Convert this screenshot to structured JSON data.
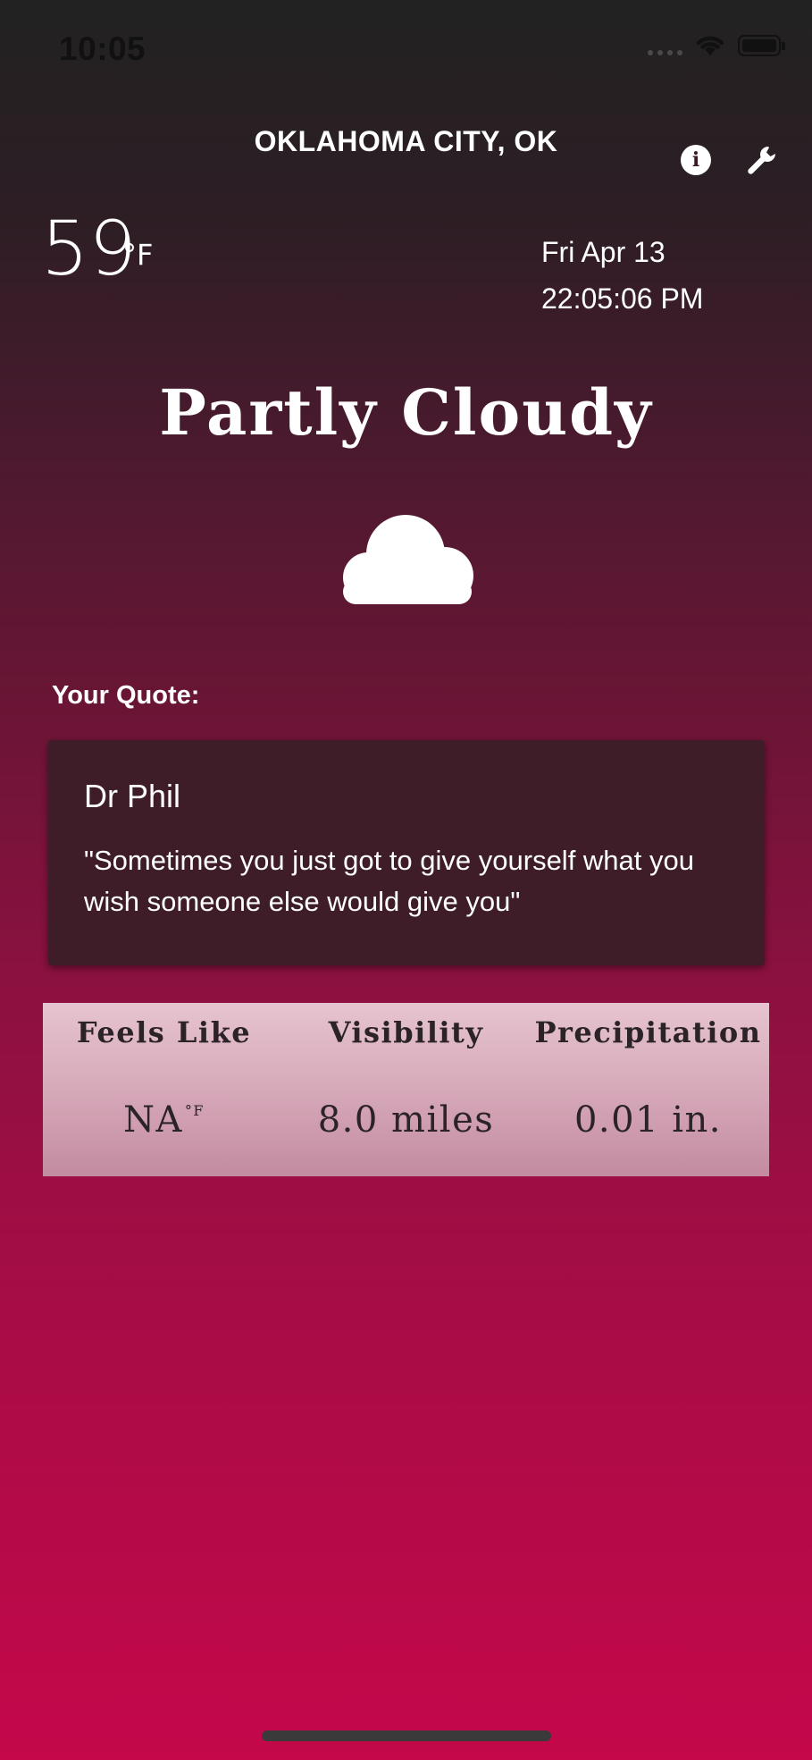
{
  "status_bar": {
    "time": "10:05",
    "wifi_icon": "wifi-icon",
    "battery_icon": "battery-icon"
  },
  "header": {
    "city": "OKLAHOMA CITY, OK",
    "info_icon_glyph": "i",
    "info_icon": "info-icon",
    "settings_icon": "wrench-icon"
  },
  "current": {
    "temperature": "59",
    "unit": "°F",
    "date": "Fri Apr 13",
    "time": "22:05:06 PM",
    "condition": "Partly Cloudy",
    "condition_icon": "cloud-icon"
  },
  "quote": {
    "label": "Your Quote:",
    "author": "Dr Phil",
    "text": "\"Sometimes you just got to give yourself what you wish someone else would give you\""
  },
  "stats": [
    {
      "label": "Feels Like",
      "value": "NA",
      "unit": "°F"
    },
    {
      "label": "Visibility",
      "value": "8.0 miles"
    },
    {
      "label": "Precipitation",
      "value": "0.01 in."
    }
  ],
  "colors": {
    "gradient_top": "#222222",
    "gradient_bottom": "#c4084a",
    "quote_card": "#3e1d29",
    "stats_panel_top": "#e6c4cf",
    "stats_panel_bottom": "#c38ba0"
  }
}
